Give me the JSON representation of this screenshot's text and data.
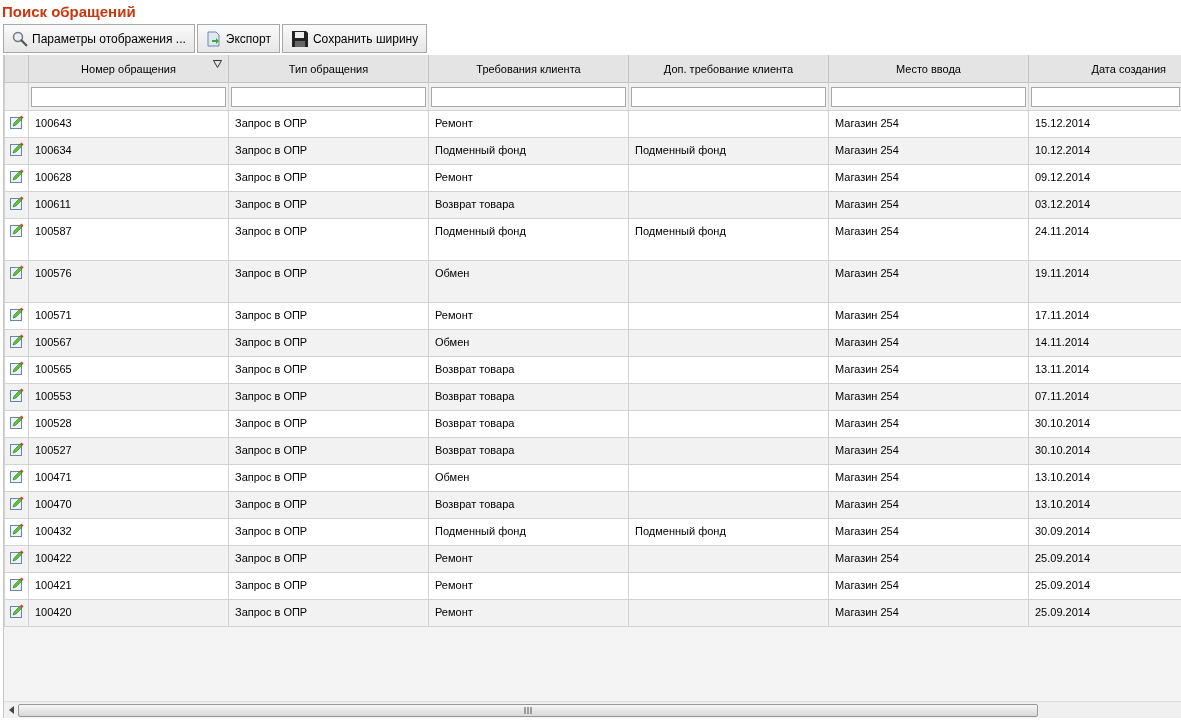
{
  "title": "Поиск обращений",
  "toolbar": [
    {
      "kind": "search",
      "label": "Параметры отображения ..."
    },
    {
      "kind": "export",
      "label": "Экспорт"
    },
    {
      "kind": "save",
      "label": "Сохранить ширину"
    }
  ],
  "table": {
    "columns": [
      {
        "label": "Номер обращения",
        "sorted": true
      },
      {
        "label": "Тип обращения",
        "sorted": false
      },
      {
        "label": "Требования клиента",
        "sorted": false
      },
      {
        "label": "Доп. требование клиента",
        "sorted": false
      },
      {
        "label": "Место ввода",
        "sorted": false
      },
      {
        "label": "Дата создания",
        "sorted": false
      }
    ],
    "rows": [
      {
        "tall": false,
        "cells": [
          "100643",
          "Запрос в ОПР",
          "Ремонт",
          "",
          "Магазин 254",
          "15.12.2014"
        ]
      },
      {
        "tall": false,
        "cells": [
          "100634",
          "Запрос в ОПР",
          "Подменный фонд",
          "Подменный фонд",
          "Магазин 254",
          "10.12.2014"
        ]
      },
      {
        "tall": false,
        "cells": [
          "100628",
          "Запрос в ОПР",
          "Ремонт",
          "",
          "Магазин 254",
          "09.12.2014"
        ]
      },
      {
        "tall": false,
        "cells": [
          "100611",
          "Запрос в ОПР",
          "Возврат товара",
          "",
          "Магазин 254",
          "03.12.2014"
        ]
      },
      {
        "tall": true,
        "cells": [
          "100587",
          "Запрос в ОПР",
          "Подменный фонд",
          "Подменный фонд",
          "Магазин 254",
          "24.11.2014"
        ]
      },
      {
        "tall": true,
        "cells": [
          "100576",
          "Запрос в ОПР",
          "Обмен",
          "",
          "Магазин 254",
          "19.11.2014"
        ]
      },
      {
        "tall": false,
        "cells": [
          "100571",
          "Запрос в ОПР",
          "Ремонт",
          "",
          "Магазин 254",
          "17.11.2014"
        ]
      },
      {
        "tall": false,
        "cells": [
          "100567",
          "Запрос в ОПР",
          "Обмен",
          "",
          "Магазин 254",
          "14.11.2014"
        ]
      },
      {
        "tall": false,
        "cells": [
          "100565",
          "Запрос в ОПР",
          "Возврат товара",
          "",
          "Магазин 254",
          "13.11.2014"
        ]
      },
      {
        "tall": false,
        "cells": [
          "100553",
          "Запрос в ОПР",
          "Возврат товара",
          "",
          "Магазин 254",
          "07.11.2014"
        ]
      },
      {
        "tall": false,
        "cells": [
          "100528",
          "Запрос в ОПР",
          "Возврат товара",
          "",
          "Магазин 254",
          "30.10.2014"
        ]
      },
      {
        "tall": false,
        "cells": [
          "100527",
          "Запрос в ОПР",
          "Возврат товара",
          "",
          "Магазин 254",
          "30.10.2014"
        ]
      },
      {
        "tall": false,
        "cells": [
          "100471",
          "Запрос в ОПР",
          "Обмен",
          "",
          "Магазин 254",
          "13.10.2014"
        ]
      },
      {
        "tall": false,
        "cells": [
          "100470",
          "Запрос в ОПР",
          "Возврат товара",
          "",
          "Магазин 254",
          "13.10.2014"
        ]
      },
      {
        "tall": false,
        "cells": [
          "100432",
          "Запрос в ОПР",
          "Подменный фонд",
          "Подменный фонд",
          "Магазин 254",
          "30.09.2014"
        ]
      },
      {
        "tall": false,
        "cells": [
          "100422",
          "Запрос в ОПР",
          "Ремонт",
          "",
          "Магазин 254",
          "25.09.2014"
        ]
      },
      {
        "tall": false,
        "cells": [
          "100421",
          "Запрос в ОПР",
          "Ремонт",
          "",
          "Магазин 254",
          "25.09.2014"
        ]
      },
      {
        "tall": false,
        "cells": [
          "100420",
          "Запрос в ОПР",
          "Ремонт",
          "",
          "Магазин 254",
          "25.09.2014"
        ]
      }
    ]
  }
}
